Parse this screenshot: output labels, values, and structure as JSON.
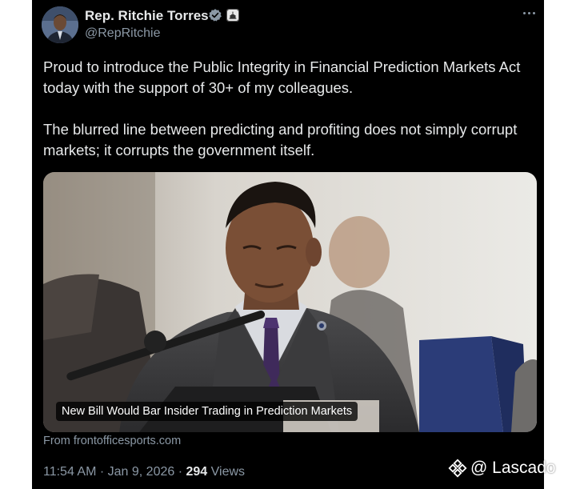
{
  "author": {
    "display_name": "Rep. Ritchie Torres",
    "handle": "@RepRitchie",
    "verified_icon": "verified-badge-icon",
    "verified_color": "#8b98a5",
    "affiliate_icon": "government-affiliate-icon"
  },
  "tweet": {
    "paragraphs": [
      "Proud to introduce the Public Integrity in Financial Prediction Markets Act today with the support of 30+ of my colleagues.",
      "The blurred line between predicting and profiting does not simply corrupt markets; it corrupts the government itself."
    ]
  },
  "media": {
    "headline": "New Bill Would Bar Insider Trading in Prediction Markets",
    "source": "From frontofficesports.com"
  },
  "meta": {
    "timestamp": "11:54 AM · Jan 9, 2026 · ",
    "views_count": "294",
    "views_label": " Views"
  },
  "watermark": {
    "text": "@ Lascado",
    "logo_icon": "binance-diamond-icon"
  },
  "colors": {
    "background": "#000000",
    "text": "#e7e9ea",
    "muted": "#8b98a5"
  }
}
